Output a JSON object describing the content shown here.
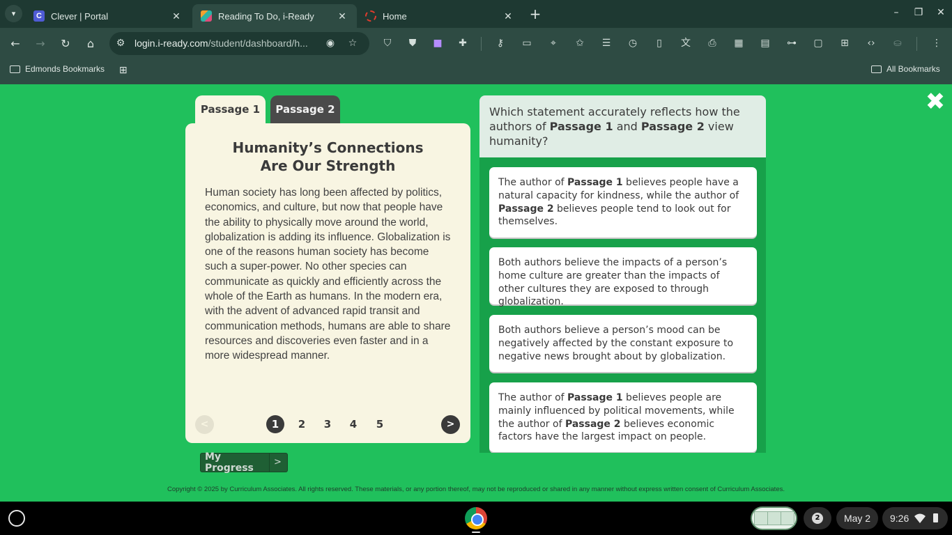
{
  "browser": {
    "tabs": [
      {
        "title": "Clever | Portal",
        "favicon": "C",
        "color": "#4f5bd5",
        "active": false
      },
      {
        "title": "Reading To Do, i-Ready",
        "favicon": "",
        "color": "#f0a030",
        "active": true
      },
      {
        "title": "Home",
        "favicon": "",
        "color": "#e03c2e",
        "active": false
      }
    ],
    "url_host": "login.i-ready.com",
    "url_path": "/student/dashboard/h...",
    "bookmarks": {
      "left": "Edmonds Bookmarks",
      "right": "All Bookmarks"
    }
  },
  "passage_tabs": [
    "Passage 1",
    "Passage 2"
  ],
  "passage": {
    "title_line1": "Humanity’s Connections",
    "title_line2": "Are Our Strength",
    "body": "Human society has long been affected by politics, economics, and culture, but now that people have the ability to physically move around the world, globalization is adding its influence. Globalization is one of the reasons human society has become such a super-power. No other species can communicate as quickly and efficiently across the whole of the Earth as humans. In the modern era, with the advent of advanced rapid transit and communication methods, humans are able to share resources and discoveries even faster and in a more widespread manner."
  },
  "pagination": {
    "prev": "<",
    "next": ">",
    "pages": [
      "1",
      "2",
      "3",
      "4",
      "5"
    ],
    "current": 1
  },
  "progress_button": {
    "label": "My Progress",
    "arrow": ">"
  },
  "question": {
    "p1": "Which statement accurately reflects how the authors of ",
    "b1": "Passage 1",
    "p2": " and ",
    "b2": "Passage 2",
    "p3": " view humanity?"
  },
  "answers": [
    {
      "t1": "The author of ",
      "b1": "Passage 1",
      "t2": " believes people have a natural capacity for kindness, while the author of ",
      "b2": "Passage 2",
      "t3": " believes people tend to look out for themselves."
    },
    {
      "t1": "Both authors believe the impacts of a person’s home culture are greater than the impacts of other cultures they are exposed to through globalization.",
      "b1": "",
      "t2": "",
      "b2": "",
      "t3": ""
    },
    {
      "t1": "Both authors believe a person’s mood can be negatively affected by the constant exposure to negative news brought about by globalization.",
      "b1": "",
      "t2": "",
      "b2": "",
      "t3": ""
    },
    {
      "t1": "The author of ",
      "b1": "Passage 1",
      "t2": " believes people are mainly influenced by political movements, while the author of ",
      "b2": "Passage 2",
      "t3": " believes economic factors have the largest impact on people."
    }
  ],
  "copyright": "Copyright © 2025 by Curriculum Associates. All rights reserved. These materials, or any portion thereof, may not be reproduced or shared in any manner without express written consent of Curriculum Associates.",
  "taskbar": {
    "notifications": "2",
    "date": "May 2",
    "time": "9:26"
  },
  "colors": {
    "page_bg": "#20c05c",
    "passage_bg": "#f8f5e2",
    "answer_panel": "#17a14a",
    "question_bg": "#e0ede5"
  }
}
